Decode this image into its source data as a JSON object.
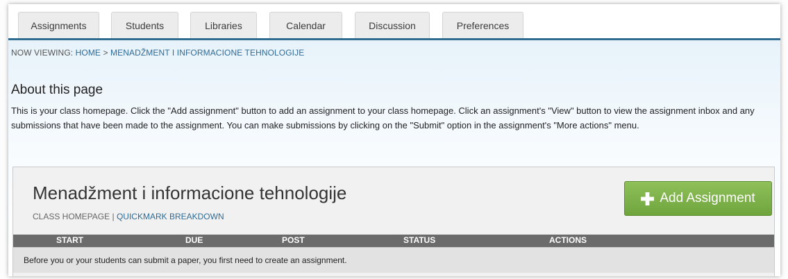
{
  "tabs": [
    "Assignments",
    "Students",
    "Libraries",
    "Calendar",
    "Discussion",
    "Preferences"
  ],
  "breadcrumb": {
    "prefix": "NOW VIEWING: ",
    "home": "HOME",
    "sep": " > ",
    "current": "MENADŽMENT I INFORMACIONE TEHNOLOGIJE"
  },
  "about": {
    "title": "About this page",
    "text": "This is your class homepage. Click the \"Add assignment\" button to add an assignment to your class homepage. Click an assignment's \"View\" button to view the assignment inbox and any submissions that have been made to the assignment. You can make submissions by clicking on the \"Submit\" option in the assignment's \"More actions\" menu."
  },
  "class_panel": {
    "title": "Menadžment i informacione tehnologije",
    "subtitle_static": "CLASS HOMEPAGE | ",
    "subtitle_link": "QUICKMARK BREAKDOWN",
    "add_button_label": "Add Assignment",
    "add_button_icon": "plus-icon",
    "add_button_color": "#7ab34a",
    "columns": [
      "START",
      "DUE",
      "POST",
      "STATUS",
      "ACTIONS"
    ],
    "empty_message": "Before you or your students can submit a paper, you first need to create an assignment."
  },
  "colors": {
    "accent": "#2e6d8f",
    "link": "#2f6b96",
    "table_header": "#6b6b6b"
  }
}
